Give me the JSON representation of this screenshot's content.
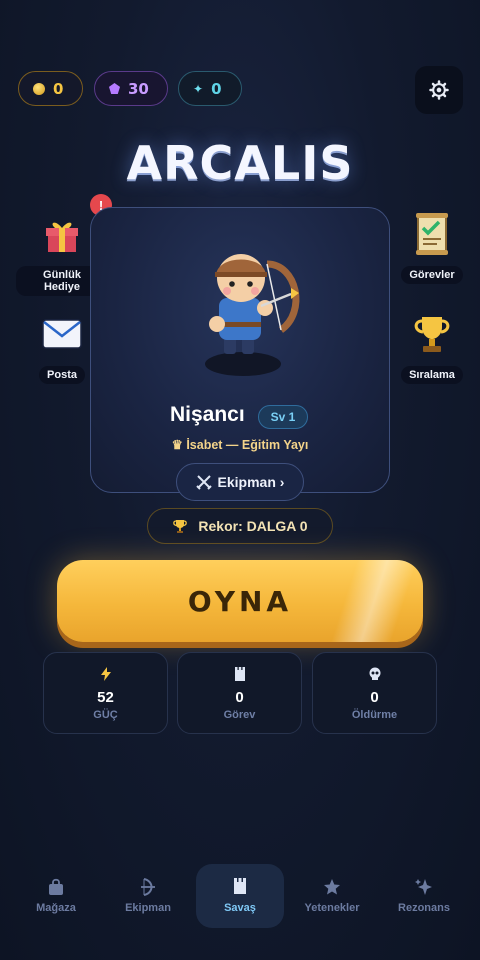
{
  "currency": {
    "gold": "0",
    "gems": "30",
    "crystals": "0"
  },
  "title": "ARCALIS",
  "side_left": [
    {
      "label": "Günlük Hediye",
      "icon": "gift-icon"
    },
    {
      "label": "Posta",
      "icon": "mail-icon"
    }
  ],
  "side_right": [
    {
      "label": "Görevler",
      "icon": "quest-scroll-icon"
    },
    {
      "label": "Sıralama",
      "icon": "trophy-icon"
    }
  ],
  "alert_badge": "!",
  "hero": {
    "name": "Nişancı",
    "level": "Sv 1",
    "weapon": "♛ İsabet — Eğitim Yayı",
    "equip_button": "Ekipman ›"
  },
  "record": "Rekor: DALGA 0",
  "play_button": "OYNA",
  "stats": [
    {
      "value": "52",
      "label": "GÜÇ",
      "icon": "lightning-icon"
    },
    {
      "value": "0",
      "label": "Görev",
      "icon": "tower-icon"
    },
    {
      "value": "0",
      "label": "Öldürme",
      "icon": "skull-icon"
    }
  ],
  "nav": [
    {
      "label": "Mağaza",
      "icon": "shop-bag-icon"
    },
    {
      "label": "Ekipman",
      "icon": "bow-icon"
    },
    {
      "label": "Savaş",
      "icon": "castle-icon",
      "active": true
    },
    {
      "label": "Yetenekler",
      "icon": "star-icon"
    },
    {
      "label": "Rezonans",
      "icon": "sparkle-icon"
    }
  ],
  "colors": {
    "background": "#121a2e",
    "gold": "#f5c542",
    "gem": "#c89cff",
    "crystal": "#5fd3e6",
    "play_button": "#f5b73b",
    "alert": "#e5484d",
    "nav_active": "#7fc8f5"
  }
}
